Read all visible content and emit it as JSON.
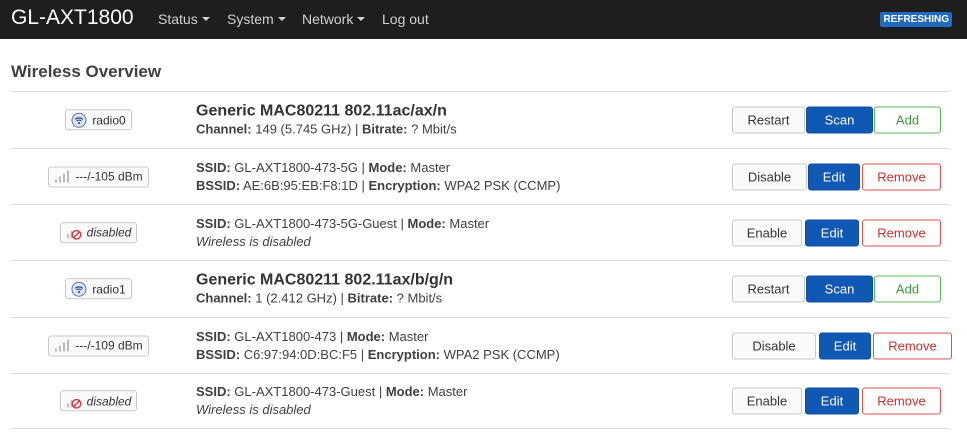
{
  "header": {
    "brand": "GL-AXT1800",
    "nav": [
      {
        "label": "Status",
        "dropdown": true
      },
      {
        "label": "System",
        "dropdown": true
      },
      {
        "label": "Network",
        "dropdown": true
      },
      {
        "label": "Log out",
        "dropdown": false
      }
    ],
    "refresh_badge": "REFRESHING"
  },
  "page_title": "Wireless Overview",
  "labels": {
    "channel": "Channel:",
    "bitrate": "Bitrate:",
    "ssid": "SSID:",
    "mode": "Mode:",
    "bssid": "BSSID:",
    "encryption": "Encryption:"
  },
  "radios": [
    {
      "badge": "radio0",
      "title": "Generic MAC80211 802.11ac/ax/n",
      "channel": "149 (5.745 GHz)",
      "bitrate": "? Mbit/s",
      "buttons": {
        "restart": "Restart",
        "scan": "Scan",
        "add": "Add"
      },
      "networks": [
        {
          "badge": "---/-105 dBm",
          "ssid": "GL-AXT1800-473-5G",
          "mode": "Master",
          "bssid": "AE:6B:95:EB:F8:1D",
          "encryption": "WPA2 PSK (CCMP)",
          "buttons": {
            "toggle": "Disable",
            "edit": "Edit",
            "remove": "Remove"
          }
        },
        {
          "badge": "disabled",
          "ssid": "GL-AXT1800-473-5G-Guest",
          "mode": "Master",
          "status": "Wireless is disabled",
          "buttons": {
            "toggle": "Enable",
            "edit": "Edit",
            "remove": "Remove"
          }
        }
      ]
    },
    {
      "badge": "radio1",
      "title": "Generic MAC80211 802.11ax/b/g/n",
      "channel": "1 (2.412 GHz)",
      "bitrate": "? Mbit/s",
      "buttons": {
        "restart": "Restart",
        "scan": "Scan",
        "add": "Add"
      },
      "networks": [
        {
          "badge": "---/-109 dBm",
          "ssid": "GL-AXT1800-473",
          "mode": "Master",
          "bssid": "C6:97:94:0D:BC:F5",
          "encryption": "WPA2 PSK (CCMP)",
          "buttons": {
            "toggle": "Disable",
            "edit": "Edit",
            "remove": "Remove"
          }
        },
        {
          "badge": "disabled",
          "ssid": "GL-AXT1800-473-Guest",
          "mode": "Master",
          "status": "Wireless is disabled",
          "buttons": {
            "toggle": "Enable",
            "edit": "Edit",
            "remove": "Remove"
          }
        }
      ]
    }
  ]
}
